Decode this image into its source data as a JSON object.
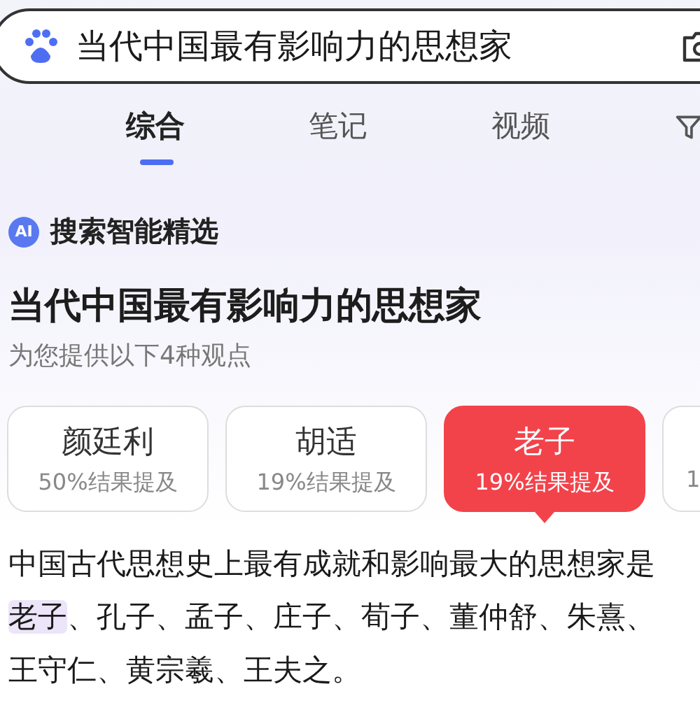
{
  "search": {
    "value": "当代中国最有影响力的思想家"
  },
  "tabs": [
    {
      "label": "综合",
      "selected": true
    },
    {
      "label": "笔记",
      "selected": false
    },
    {
      "label": "视频",
      "selected": false
    }
  ],
  "ai_header": {
    "badge": "AI",
    "label": "搜索智能精选"
  },
  "title": "当代中国最有影响力的思想家",
  "subtitle": "为您提供以下4种观点",
  "options": [
    {
      "name": "颜廷利",
      "share": "50%结果提及",
      "selected": false
    },
    {
      "name": "胡适",
      "share": "19%结果提及",
      "selected": false
    },
    {
      "name": "老子",
      "share": "19%结果提及",
      "selected": true
    },
    {
      "share": "1",
      "selected": false
    }
  ],
  "answer": {
    "intro": "中国古代思想史上最有成就和影响最大的思想家是",
    "highlight": "老子",
    "rest": "、孔子、孟子、庄子、荀子、董仲舒、朱熹、王守仁、黄宗羲、王夫之。"
  }
}
